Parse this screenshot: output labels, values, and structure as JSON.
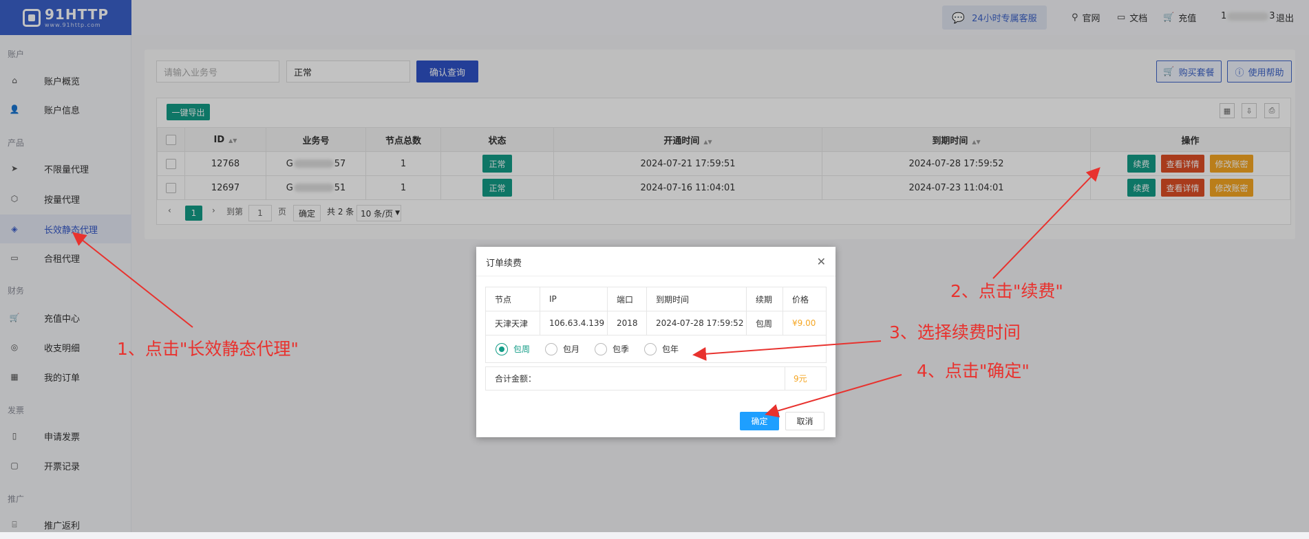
{
  "logo": {
    "title": "91HTTP",
    "subtitle": "www.91http.com"
  },
  "header": {
    "customer_service": "24小时专属客服",
    "links": [
      "官网",
      "文档",
      "充值"
    ],
    "user": "1",
    "user_suffix": "3",
    "logout": "退出"
  },
  "sidebar": {
    "sections": [
      {
        "title": "账户",
        "items": [
          "账户概览",
          "账户信息"
        ]
      },
      {
        "title": "产品",
        "items": [
          "不限量代理",
          "按量代理",
          "长效静态代理",
          "合租代理"
        ]
      },
      {
        "title": "财务",
        "items": [
          "充值中心",
          "收支明细",
          "我的订单"
        ]
      },
      {
        "title": "发票",
        "items": [
          "申请发票",
          "开票记录"
        ]
      },
      {
        "title": "推广",
        "items": [
          "推广返利"
        ]
      }
    ],
    "active_item": "长效静态代理"
  },
  "search": {
    "placeholder": "请输入业务号",
    "status_value": "正常",
    "query_button": "确认查询",
    "buy_button": "购买套餐",
    "help_button": "使用帮助"
  },
  "table": {
    "export_button": "一键导出",
    "columns": [
      "ID",
      "业务号",
      "节点总数",
      "状态",
      "开通时间",
      "到期时间",
      "操作"
    ],
    "rows": [
      {
        "id": "12768",
        "biz_prefix": "G",
        "biz_suffix": "57",
        "nodes": "1",
        "status": "正常",
        "open_time": "2024-07-21 17:59:51",
        "expire_time": "2024-07-28 17:59:52"
      },
      {
        "id": "12697",
        "biz_prefix": "G",
        "biz_suffix": "51",
        "nodes": "1",
        "status": "正常",
        "open_time": "2024-07-16 11:04:01",
        "expire_time": "2024-07-23 11:04:01"
      }
    ],
    "actions": [
      "续费",
      "查看详情",
      "修改账密"
    ]
  },
  "pagination": {
    "current": "1",
    "goto_label": "到第",
    "page_input": "1",
    "page_unit": "页",
    "confirm": "确定",
    "total": "共 2 条",
    "page_size": "10 条/页"
  },
  "modal": {
    "title": "订单续费",
    "columns": [
      "节点",
      "IP",
      "端口",
      "到期时间",
      "续期",
      "价格"
    ],
    "row": {
      "node": "天津天津",
      "ip": "106.63.4.139",
      "port": "2018",
      "expire": "2024-07-28 17:59:52",
      "period": "包周",
      "price": "¥9.00"
    },
    "options": [
      "包周",
      "包月",
      "包季",
      "包年"
    ],
    "selected_option": "包周",
    "total_label": "合计金额：",
    "total_value": "9元",
    "ok_button": "确定",
    "cancel_button": "取消"
  },
  "annotations": {
    "step1": "1、点击\"长效静态代理\"",
    "step2": "2、点击\"续费\"",
    "step3": "3、选择续费时间",
    "step4": "4、点击\"确定\""
  },
  "colors": {
    "brand": "#3b61c9",
    "green": "#139c87",
    "red": "#dd4e26",
    "orange": "#f5a623",
    "annotation": "#e8322e"
  }
}
